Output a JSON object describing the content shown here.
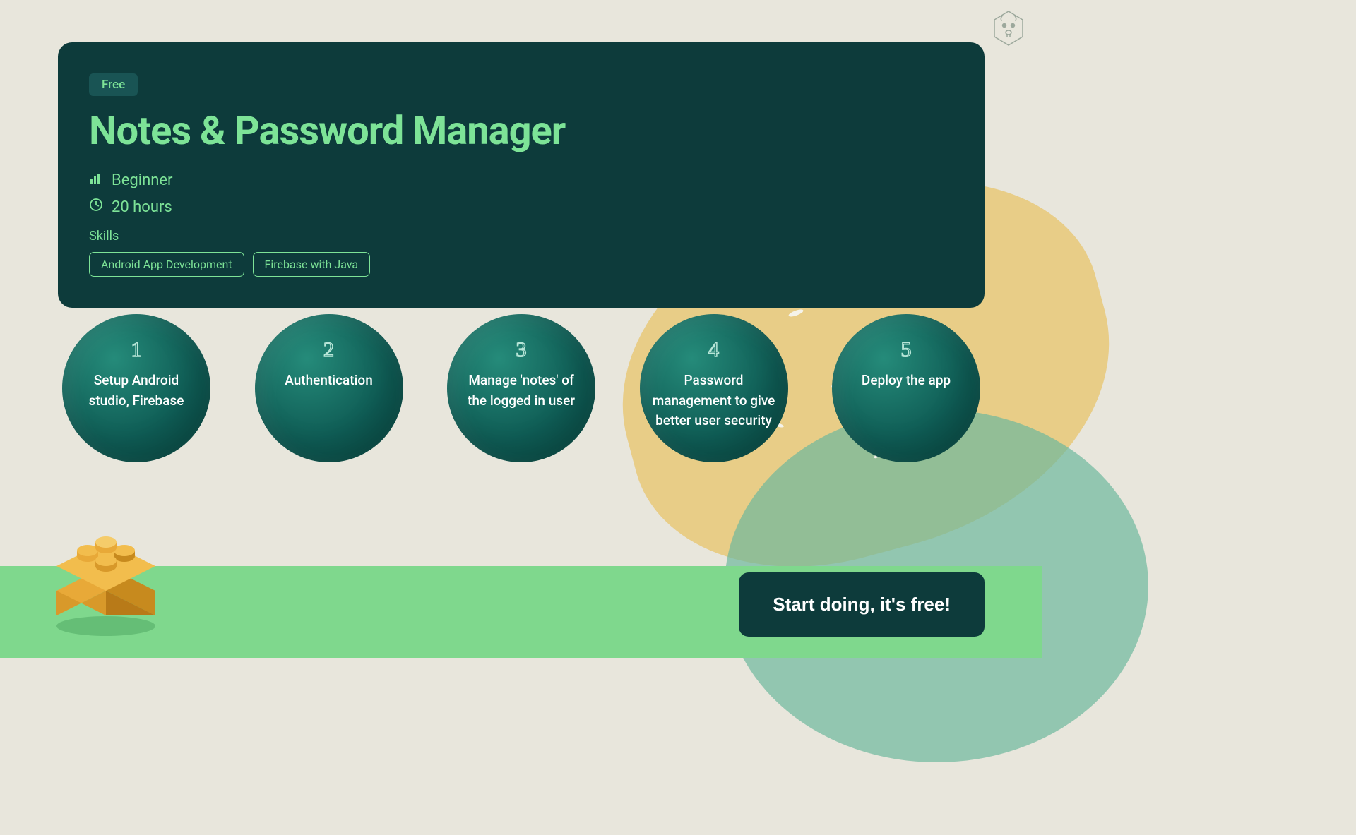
{
  "header": {
    "badge": "Free",
    "title": "Notes & Password Manager",
    "level": "Beginner",
    "duration": "20 hours",
    "skills_label": "Skills",
    "skills": [
      "Android App Development",
      "Firebase with Java"
    ]
  },
  "steps": [
    {
      "number": "1",
      "text": "Setup Android studio, Firebase"
    },
    {
      "number": "2",
      "text": "Authentication"
    },
    {
      "number": "3",
      "text": "Manage 'notes' of the logged in user"
    },
    {
      "number": "4",
      "text": "Password management to give better user security"
    },
    {
      "number": "5",
      "text": "Deploy the app"
    }
  ],
  "cta": {
    "label": "Start doing, it's free!"
  }
}
